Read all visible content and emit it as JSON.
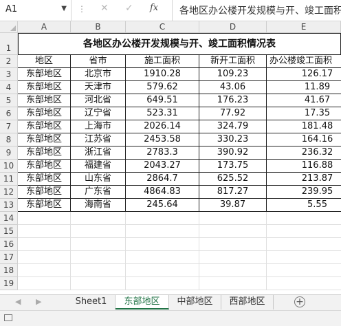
{
  "formula_bar": {
    "name_box": "A1",
    "fx": "fx",
    "content": "各地区办公楼开发规模与开、竣工面积情况表"
  },
  "columns": [
    "A",
    "B",
    "C",
    "D",
    "E"
  ],
  "rows": [
    "1",
    "2",
    "3",
    "4",
    "5",
    "6",
    "7",
    "8",
    "9",
    "10",
    "11",
    "12",
    "13",
    "14",
    "15",
    "16",
    "17",
    "18",
    "19"
  ],
  "sheet": {
    "title": "各地区办公楼开发规模与开、竣工面积情况表",
    "headers": [
      "地区",
      "省市",
      "施工面积",
      "新开工面积",
      "办公楼竣工面积"
    ],
    "data": [
      [
        "东部地区",
        "北京市",
        "1910.28",
        "109.23",
        "126.17"
      ],
      [
        "东部地区",
        "天津市",
        "579.62",
        "43.06",
        "11.89"
      ],
      [
        "东部地区",
        "河北省",
        "649.51",
        "176.23",
        "41.67"
      ],
      [
        "东部地区",
        "辽宁省",
        "523.31",
        "77.92",
        "17.35"
      ],
      [
        "东部地区",
        "上海市",
        "2026.14",
        "324.79",
        "181.48"
      ],
      [
        "东部地区",
        "江苏省",
        "2453.58",
        "330.23",
        "164.16"
      ],
      [
        "东部地区",
        "浙江省",
        "2783.3",
        "390.92",
        "236.32"
      ],
      [
        "东部地区",
        "福建省",
        "2043.27",
        "173.75",
        "116.88"
      ],
      [
        "东部地区",
        "山东省",
        "2864.7",
        "625.52",
        "213.87"
      ],
      [
        "东部地区",
        "广东省",
        "4864.83",
        "817.27",
        "239.95"
      ],
      [
        "东部地区",
        "海南省",
        "245.64",
        "39.87",
        "5.55"
      ]
    ]
  },
  "tabs": [
    {
      "label": "Sheet1",
      "active": false
    },
    {
      "label": "东部地区",
      "active": true
    },
    {
      "label": "中部地区",
      "active": false
    },
    {
      "label": "西部地区",
      "active": false
    }
  ],
  "colors": {
    "active_tab": "#217346"
  }
}
